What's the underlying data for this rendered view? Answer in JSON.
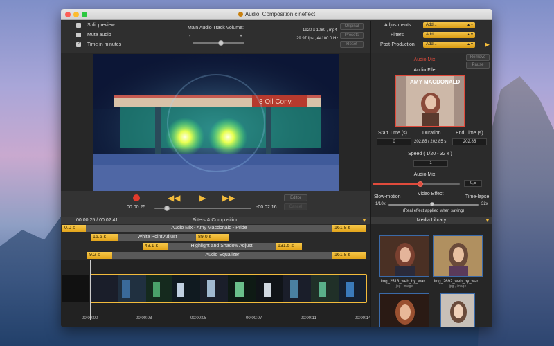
{
  "window": {
    "title": "Audio_Composition.cineffect"
  },
  "options": {
    "split_preview": "Split preview",
    "mute_audio": "Mute audio",
    "time_in_minutes": "Time in minutes"
  },
  "audio_volume": {
    "label": "Main Audio Track Volume:",
    "minus": "-",
    "plus": "+",
    "value": 0.55
  },
  "video_info": {
    "resolution": "1920 x 1080 , mp4",
    "rates": "29.97 fps , 44100.0 Hz"
  },
  "buttons": {
    "original": "Original",
    "presets": "Presets",
    "reset": "Reset",
    "editor": "Editor",
    "cancel": "Cancel",
    "remove": "Remove",
    "pause": "Pause"
  },
  "effects": {
    "adjustments": "Adjustments",
    "filters": "Filters",
    "post_production": "Post-Production",
    "add": "Add..."
  },
  "audio_mix": {
    "title": "Audio Mix",
    "file_label": "Audio File",
    "album_title": "AMY MACDONALD",
    "start_label": "Start Time (s)",
    "duration_label": "Duration",
    "end_label": "End Time (s)",
    "start": "0",
    "duration": "202.85 / 202.85 s",
    "end": "202,85",
    "speed_label": "Speed ( 1/20 - 32 x )",
    "speed": "1",
    "mix_label": "Audio Mix",
    "mix_value": "0,5"
  },
  "transport": {
    "current": "00:00:25",
    "remaining": "-00:02:16",
    "progress": 0.13
  },
  "video_effect": {
    "title": "Video Effect",
    "slow": "Slow-motion",
    "timelapse": "Time-lapse",
    "min": "1/10x",
    "max": "32x",
    "note": "(Real effect applied when saving)"
  },
  "timeline": {
    "time": "00:00:25 / 00:02:41",
    "header": "Filters & Composition",
    "rows": [
      {
        "start": "0.0 s",
        "name": "Audio Mix - Amy Macdonald - Pride",
        "end": "161.8 s"
      },
      {
        "start": "15.6 s",
        "name": "White Point Adjust",
        "end": "89.0 s"
      },
      {
        "start": "43.1 s",
        "name": "Highlight and Shadow Adjust",
        "end": "131.5 s"
      },
      {
        "start": "9.2 s",
        "name": "Audio Equalizer",
        "end": "161.8 s"
      }
    ],
    "ticks": [
      "00:00:00",
      "00:00:03",
      "00:00:05",
      "00:00:07",
      "00:00:11",
      "00:00:14"
    ]
  },
  "media_library": {
    "title": "Media Library",
    "items": [
      {
        "name": "img_2513_web_by_war...",
        "type": "jpg , image"
      },
      {
        "name": "img_2692_web_by_war...",
        "type": "jpg , image"
      }
    ]
  },
  "colors": {
    "accent": "#f2bb3c",
    "record": "#e23a2c",
    "audio_mix_title": "#e04b3c"
  }
}
